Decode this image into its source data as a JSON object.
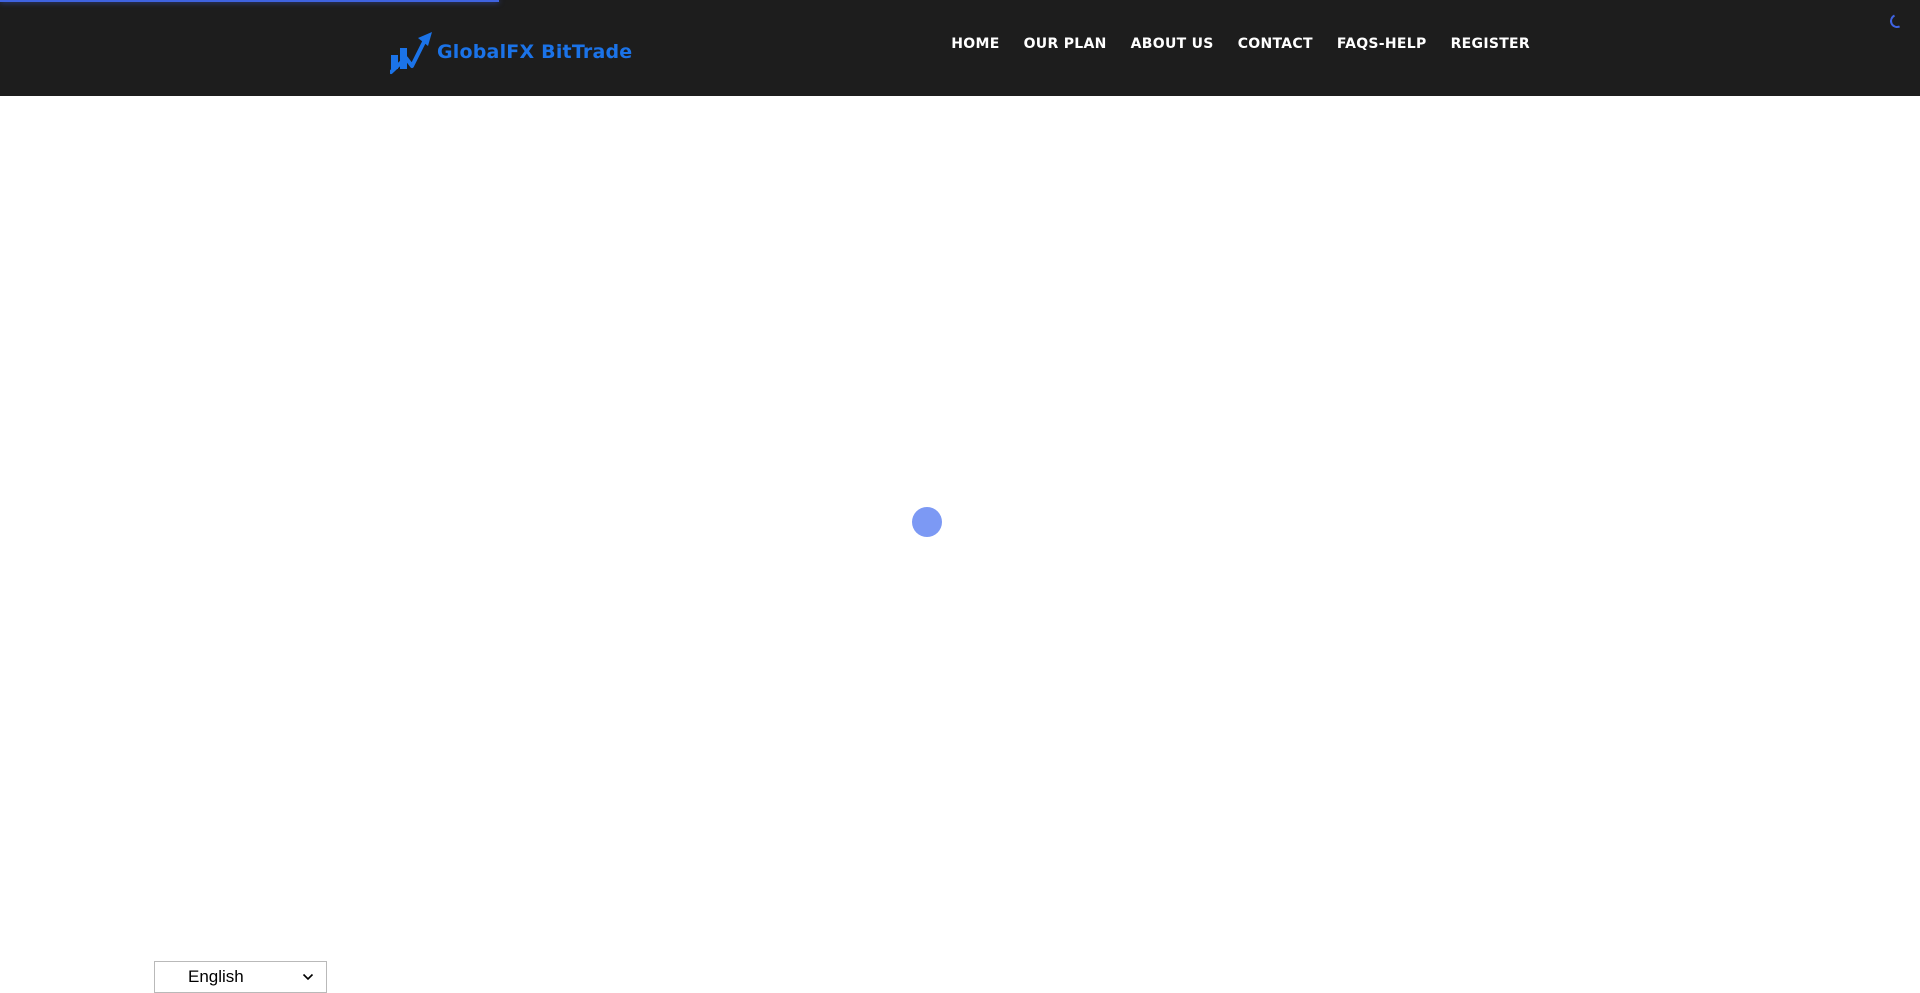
{
  "header": {
    "logo_text": "GlobalFX BitTrade",
    "logo_icon": "rising-chart-arrow-icon",
    "nav": [
      {
        "label": "HOME"
      },
      {
        "label": "OUR PLAN"
      },
      {
        "label": "ABOUT US"
      },
      {
        "label": "CONTACT"
      },
      {
        "label": "FAQS-HELP"
      },
      {
        "label": "REGISTER"
      }
    ]
  },
  "page_loading": {
    "progress": 0.26,
    "bar_color": "#3f63e0",
    "preloader_color": "#7c99f4",
    "corner_spinner_icon": "loading-spinner-icon"
  },
  "language": {
    "selected": "English",
    "dropdown_icon": "chevron-down-icon"
  },
  "colors": {
    "header_bg": "#1d1d1d",
    "brand_blue": "#1b73e8",
    "nav_text": "#ffffff",
    "page_bg": "#ffffff"
  }
}
